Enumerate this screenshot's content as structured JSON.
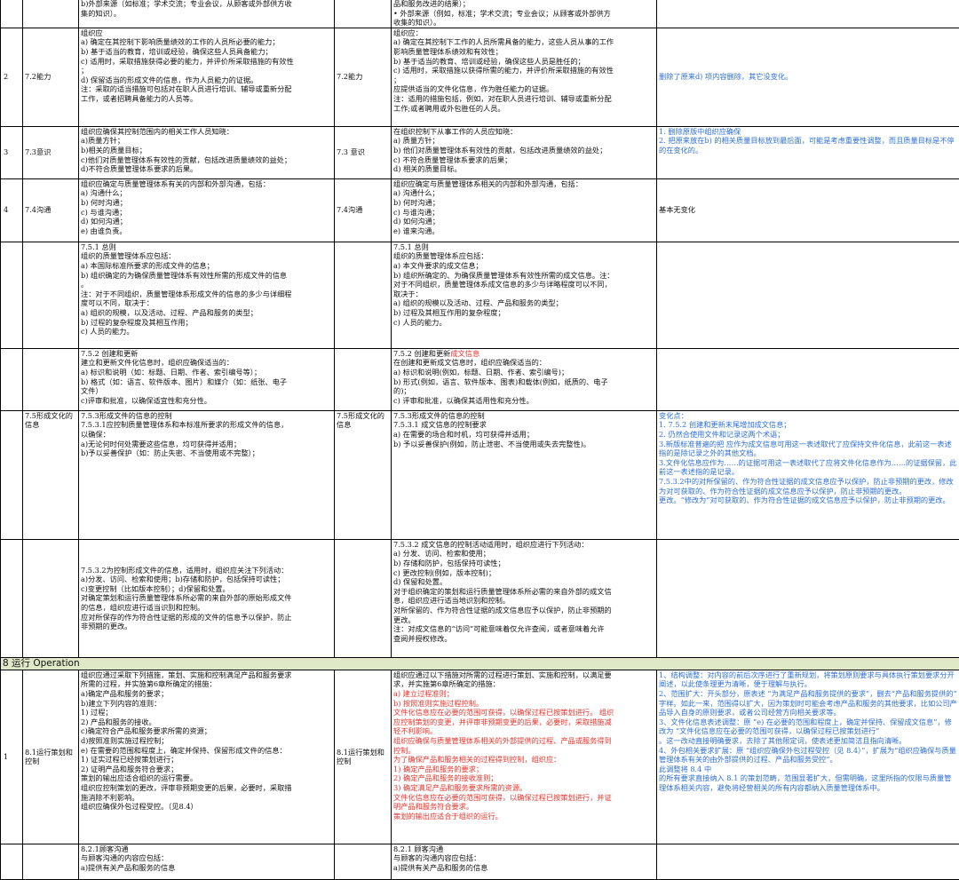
{
  "rows": {
    "r0": {
      "old_content": [
        "b)外部来源（如标准；学术交流；专业会议，从顾客或外部供方收",
        "集的知识）。"
      ],
      "new_content": [
        "品和服务改进的结果）；",
        "• 外部来源（例如，标准；学术交流；专业会议；从顾客或外部供方",
        "收集的知识）。"
      ]
    },
    "r1": {
      "num": "2",
      "old_clause": "7.2能力",
      "old_content": [
        "组织应",
        "a) 确定在其控制下影响质量绩效的工作的人员所必要的能力；",
        "b) 基于适当的教育，培训或经验，确保这些人员具备能力；",
        "c) 适用时，采取措施获得必要的能力，并评价所采取措施的有效性",
        "；",
        "d) 保留适当的形成文件的信息，作为人员能力的证据。",
        "注：采取的适当措施可包括对在职人员进行培训、辅导或重新分配",
        "工作，或者招聘具备能力的人员等。"
      ],
      "new_clause": "7.2能力",
      "new_content": [
        "组织应：",
        "a) 确定在其控制下工作的人员所需具备的能力，这些人员从事的工作",
        "影响质量管理体系绩效和有效性；",
        "b) 基于适当的教育、培训或经验，确保这些人员是胜任的；",
        "c) 适用时，采取措施以获得所需的能力，并评价所采取措施的有效性",
        "；",
        "应提供适当的文件化信息，作为胜任能力的证据。",
        "注：适用的措施包括，例如，对在职人员进行培训、辅导或重新分配",
        "工作;或者聘用或外包胜任的人员。"
      ],
      "note": [
        "删除了原来d) 项内容删除，其它没变化。"
      ]
    },
    "r2": {
      "num": "3",
      "old_clause": "7.3意识",
      "old_content": [
        "组织应确保其控制范围内的相关工作人员知晓：",
        "a)质量方针；",
        "b)相关的质量目标；",
        "c)他们对质量管理体系有效性的贡献，包括改进质量绩效的益处；",
        "d)不符合质量管理体系要求的后果。"
      ],
      "new_clause": "7.3 意识",
      "new_content": [
        "在组织控制下从事工作的人员应知晓：",
        "a) 质量方针；",
        "b) 他们对质量管理体系有效性的贡献，包括改进质量绩效的益处；",
        "c) 不符合质量管理体系要求的后果；",
        "d) 相关的质量目标。"
      ],
      "note": [
        "1. 删除原版中组织应确保",
        "2. 把原来放在b) 的相关质量目标放到最后面，可能是考虑重要性调整，而且质量目标是不停的在变化的。"
      ]
    },
    "r3": {
      "num": "4",
      "old_clause": "7.4沟通",
      "old_content": [
        "组织应确定与质量管理体系有关的内部和外部沟通，包括：",
        "a) 沟通什么；",
        "b) 何时沟通；",
        "c) 与谁沟通；",
        "d) 如何沟通；",
        "e) 由谁负责。"
      ],
      "new_clause": "7.4沟通",
      "new_content": [
        "组织应确定与质量管理体系相关的内部和外部沟通，包括：",
        "a) 沟通什么；",
        "b) 何时沟通；",
        "c) 与谁沟通；",
        "d) 如何沟通；",
        "e) 谁来沟通。"
      ],
      "note": [
        "基本无变化"
      ]
    },
    "r4": {
      "old_content": [
        "7.5.1 总则",
        "组织的质量管理体系应包括：",
        "a) 本国际标准所要求的形成文件的信息；",
        "b) 组织确定的为确保质量管理体系有效性所需的形成文件的信息",
        "。",
        "注：对于不同组织，质量管理体系形成文件的信息的多少与详细程",
        "度可以不同，取决于：",
        "a) 组织的规模，以及活动、过程、产品和服务的类型；",
        "b) 过程的复杂程度及其相互作用；",
        "c) 人员的能力。"
      ],
      "new_content": [
        "7.5.1 总则",
        "组织的质量管理体系应包括：",
        "a) 本文件要求的成文信息；",
        "b) 组织所确定的、为确保质量管理体系有效性所需的成文信息。注：",
        "对于不同组织，质量管理体系成文信息的多少与详略程度可以不同，",
        "取决于：",
        "a) 组织的规模以及活动、过程、产品和服务的类型；",
        "b) 过程及其相互作用的复杂程度；",
        "c) 人员的能力。"
      ]
    },
    "r5": {
      "old_content": [
        "7.5.2 创建和更新",
        "建立和更新文件化信息时，组织应确保适当的：",
        "a) 标识和说明（如：标题、日期、作者、索引编号等）；",
        "b) 格式（如：语言、软件版本、图片）和媒介（如：纸张、电子",
        "文件）",
        "c)评审和批准，以确保适宜性和充分性。"
      ],
      "new_title": "7.5.2 创建和更新",
      "new_title_red": "成文信息",
      "new_content": [
        "在创建和更新成文信息时，组织应确保适当的：",
        "a) 标识和说明(例如，标题、日期、作者、索引编号)；",
        "b) 形式(例如，语言、软件版本、图表)和载体(例如，纸质的、电子",
        "的)；",
        "c) 评审和批准，以确保其适用性和充分性。"
      ]
    },
    "r6": {
      "old_clause": "7.5形成文化的信息",
      "old_content": [
        "7.5.3形成文件的信息的控制",
        "7.5.3.1应控制质量管理体系和本标准所要求的形成文件的信息，",
        "以确保：",
        "a)无论何时何处需要这些信息，均可获得并适用；",
        "b)予以妥善保护（如：防止失密、不当使用或不完整）；"
      ],
      "new_clause": "7.5形成文化的信息",
      "new_content": [
        "7.5.3形成文件的信息的控制",
        "7.5.3.1 成文信息的控制要求",
        "a) 在需要的场合和时机，均可获得并适用；",
        "b) 予以妥善保护(例如，防止泄密、不当使用或失去完整性)。"
      ],
      "note": [
        "变化点：",
        "1. 7.5.2 创建和更新末尾增加成文信息；",
        "2. 仍然合使用文件和记录这两个术语；",
        "3.新版标准普遍的把 应作为成文信息可用这一表述取代了应保持文件化信息，此前这一表述指的是除记录之外的其他文档。",
        "3.文件化信息应作为……的证据可用这一表述取代了应将文件化信息作为……的证据保留，此前这一表述指的是记录。",
        "7.5.3.2中的对所保留的、作为符合性证据的成文信息应予以保护，防止非预期的更改，修改为对可获取的、作为符合性证据的成文信息应予以保护，防止非预期的更改。",
        "更改。“修改为”对可获取的、作为符合性证据的成文信息应予以保护，防止非预期的更改。"
      ]
    },
    "r7": {
      "old_content": [
        "7.5.3.2为控制形成文件的信息，适用时，组织应关注下列活动：",
        "a)分发、访问、检索和使用；b)存储和防护，包括保持可读性；",
        "c)变更控制（比如版本控制）；d)保留和处置。",
        "对确定策划和运行质量管理体系所必需的来自外部的原始形成文件",
        "的信息，组织应进行适当识别和控制。",
        "应对所保存的作为符合性证据的形成的文件的信息予以保护，防止",
        "非预期的更改。"
      ],
      "new_content": [
        "7.5.3.2 成文信息的控制活动适用时，组织应进行下列活动：",
        "a) 分发、访问、检索和使用；",
        "b) 存储和防护，包括保持可读性；",
        "c) 更改控制(例如，版本控制)；",
        "d) 保留和处置。",
        "对于组织确定的策划和运行质量管理体系所必需的来自外部的成文信",
        "息，组织应进行适当地识别和控制。",
        "对所保留的、作为符合性证据的成文信息应予以保护，防止非预期的",
        "更改。",
        "注：对成文信息的“访问”可能意味着仅允许查阅，或者意味着允许",
        "查阅并授权修改。"
      ]
    },
    "section": {
      "label": "8 运行 Operation"
    },
    "r8": {
      "num": "1",
      "old_clause": "8.1运行策划和控制",
      "old_content": [
        "组织应通过采取下列措施，策划、实施和控制满足产品和服务要求",
        "所需的过程，并实施第6章所确定的措施：",
        "a)确定产品和服务的要求；",
        "b)建立下列内容的准则：",
        "1) 过程；",
        "2) 产品和服务的接收。",
        "c)确定符合产品和服务要求所需的资源；",
        "d)按照准则实施过程控制；",
        "e) 在需要的范围和程度上，确定并保持、保留形成文件的信息：",
        "1) 证实过程已经按策划进行；",
        "2) 证明产品和服务符合要求；",
        "策划的输出应适合组织的运行需要。",
        "组织应控制策划的更改，评审非预期变更的后果，必要时，采取措",
        "施消除不利影响。",
        "组织应确保外包过程受控。（见8.4）"
      ],
      "new_clause": "8.1运行策划和控制",
      "new_content": [
        {
          "t": "组织应通过以下措施对所需的过程进行策划、实施和控制，以满足要",
          "c": ""
        },
        {
          "t": "求，并实施第6章所确定的措施：",
          "c": ""
        },
        {
          "t": "a) 建立过程准则；",
          "c": "red"
        },
        {
          "t": "b) 按照准则实施过程控制。",
          "c": "red"
        },
        {
          "t": "文件化信息应在必要的范围可获得，以确保过程已按策划进行。 组织",
          "c": "red"
        },
        {
          "t": "应控制策划的变更，并评审非预期变更的后果，必要时，采取措施减",
          "c": "red"
        },
        {
          "t": "轻不利影响。",
          "c": "red"
        },
        {
          "t": "组织应确保与质量管理体系相关的外部提供的过程、产品或服务得到",
          "c": "red"
        },
        {
          "t": "控制。",
          "c": "red"
        },
        {
          "t": "为了确保产品和服务相关的过程得到控制，组织应：",
          "c": "red"
        },
        {
          "t": "1) 确定产品和服务的要求；",
          "c": "red"
        },
        {
          "t": "2) 确定产品和服务的接收准则；",
          "c": "red"
        },
        {
          "t": "3) 确定满足产品和服务要求所需的资源。",
          "c": "red"
        },
        {
          "t": "文件化信息应在必要的范围可获得，以确保过程已按策划进行，并证",
          "c": "red"
        },
        {
          "t": "明产品和服务符合要求。",
          "c": "red"
        },
        {
          "t": "策划的输出应适合于组织的运行。",
          "c": "red"
        }
      ],
      "note": [
        "1、结构调整：对内容的前后次序进行了重新规划，将策划原则要求与具体执行策划要求分开阐述，以此使条理更为清晰，便于理解与执行。",
        "2、范围扩大：开头部分，原表述 “为满足产品和服务提供的要求”，删去“产品和服务提供的” 字样。如此一来，范围得以扩大，因为策划时可能会考虑产品和服务的其他要求，比如公司产品导入自身的原则要求，或者公司经营方向相关要求等。",
        "3、文件化信息表述调整：原 “e) 在必要的范围和程度上，确定并保持、保留成文信息”，修改为 “文件化信息应在必要的范围可获得，以确保过程已按策划进行”",
        "。这一改动直接明确要求，去除了其他限定词，使表述更加简洁且指向清晰。",
        "4、外包相关要求扩展：原 “组织应确保外包过程受控（见 8.4）”，扩展为“组织应确保与质量管理体系有关的由外部提供的过程、产品和服务受控”。",
        "此调整将 8.4 中",
        "的所有要求直接纳入 8.1 的策划范畴，范围显著扩大，但需明确，这里所指的仅限与质量管理体系相关内容，避免将经营相关的所有内容都纳入质量管理体系中。"
      ]
    },
    "r9": {
      "old_content": [
        "8.2.1顾客沟通",
        "与顾客沟通的内容应包括：",
        "a)提供有关产品和服务的信息"
      ],
      "new_content": [
        "8.2.1 顾客沟通",
        "与顾客的沟通内容应包括：",
        "a)提供有关产品和服务的信息"
      ]
    }
  }
}
